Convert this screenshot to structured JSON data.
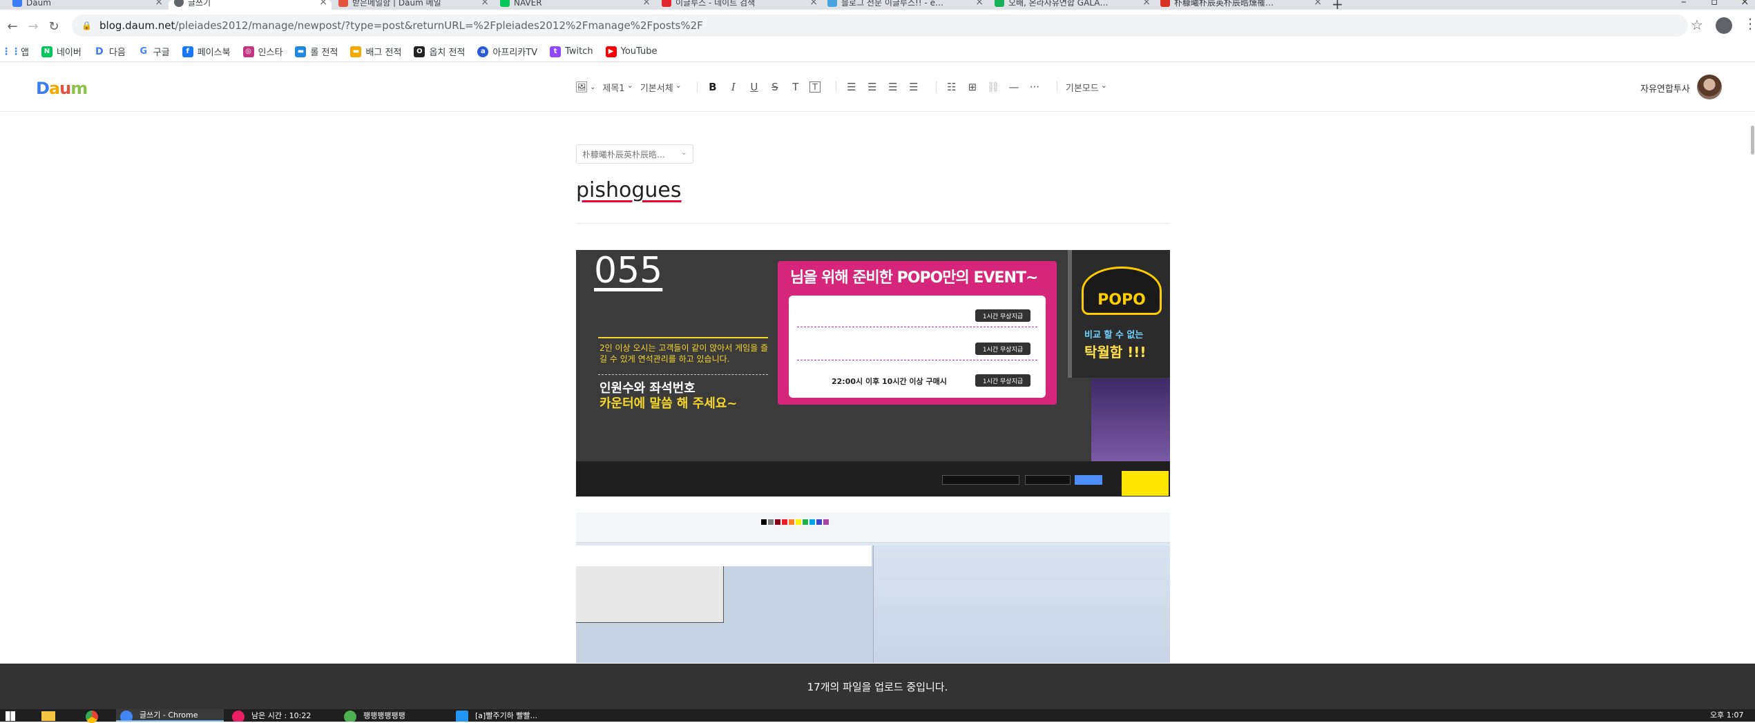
{
  "browser": {
    "tabs": [
      {
        "title": "Daum",
        "color": "#3b7df2",
        "active": false
      },
      {
        "title": "글쓰기",
        "color": "#5f6368",
        "active": true
      },
      {
        "title": "받은메일함 | Daum 메일",
        "color": "#e2543f",
        "active": false
      },
      {
        "title": "NAVER",
        "color": "#03c75a",
        "active": false
      },
      {
        "title": "이글루스 - 네이트 검색",
        "color": "#e0282e",
        "active": false
      },
      {
        "title": "블로그 전문 이글루스!! - egloos",
        "color": "#4aa3df",
        "active": false
      },
      {
        "title": "오배, 온라사유연합 GALAXY LIVE",
        "color": "#18b158",
        "active": false
      },
      {
        "title": "朴糠曦朴辰英朴辰晧燻罹瑰pishogues",
        "color": "#d93025",
        "active": false
      }
    ],
    "new_tab": "+",
    "address": {
      "host": "blog.daum.net",
      "path": "/pleiades2012/manage/newpost/?type=post&returnURL=%2Fpleiades2012%2Fmanage%2Fposts%2F"
    },
    "bookmarks": [
      {
        "label": "앱",
        "color": "#4285f4"
      },
      {
        "label": "네이버",
        "color": "#03c75a"
      },
      {
        "label": "다음",
        "color": "#3b7df2"
      },
      {
        "label": "구글",
        "color": "#ffffff"
      },
      {
        "label": "페이스북",
        "color": "#1877f2"
      },
      {
        "label": "인스타",
        "color": "#c13584"
      },
      {
        "label": "롤 전적",
        "color": "#1e88e5"
      },
      {
        "label": "배그 전적",
        "color": "#f2a900"
      },
      {
        "label": "옵치 전적",
        "color": "#222222"
      },
      {
        "label": "아프리카TV",
        "color": "#2b5cd6"
      },
      {
        "label": "Twitch",
        "color": "#9146ff"
      },
      {
        "label": "YouTube",
        "color": "#ff0000"
      }
    ]
  },
  "editor": {
    "logo": "Daum",
    "toolbar": {
      "heading": "제목1",
      "font": "기본서체",
      "mode": "기본모드"
    },
    "user_name": "자유연합투사",
    "category_placeholder": "朴糠曦朴辰英朴辰晧…",
    "post_title": "pishogues"
  },
  "image1": {
    "seat_number": "055",
    "info_small": "2인 이상 오시는 고객들이 같이 앉아서 게임을 즐길 수 있게 연석관리를 하고 있습니다.",
    "info_big1": "인원수와 좌석번호",
    "info_big2": "카운터에 말씀 해 주세요~",
    "event_title": "님을 위해 준비한 POPO만의 EVENT~",
    "event_badges": [
      "1시간 무상지급",
      "1시간 무상지급",
      "1시간 무상지급"
    ],
    "event_time": "22:00시 이후 10시간 이상 구매시",
    "popo_logo": "POPO",
    "compare_line1": "비교 할 수 없는",
    "compare_line2": "탁월함 !!!"
  },
  "upload_status": "17개의 파일을 업로드 중입니다.",
  "taskbar": {
    "apps": [
      {
        "label": "글쓰기 - Chrome",
        "color": "#4285f4",
        "active": true
      },
      {
        "label": "남은 시간 : 10:22",
        "color": "#e91e63",
        "active": false
      },
      {
        "label": "팽팽팽팽팽팽",
        "color": "#4caf50",
        "active": false
      },
      {
        "label": "[a]빨주기하 빨빨...",
        "color": "#2196f3",
        "active": false
      }
    ],
    "clock": "오후 1:07"
  }
}
